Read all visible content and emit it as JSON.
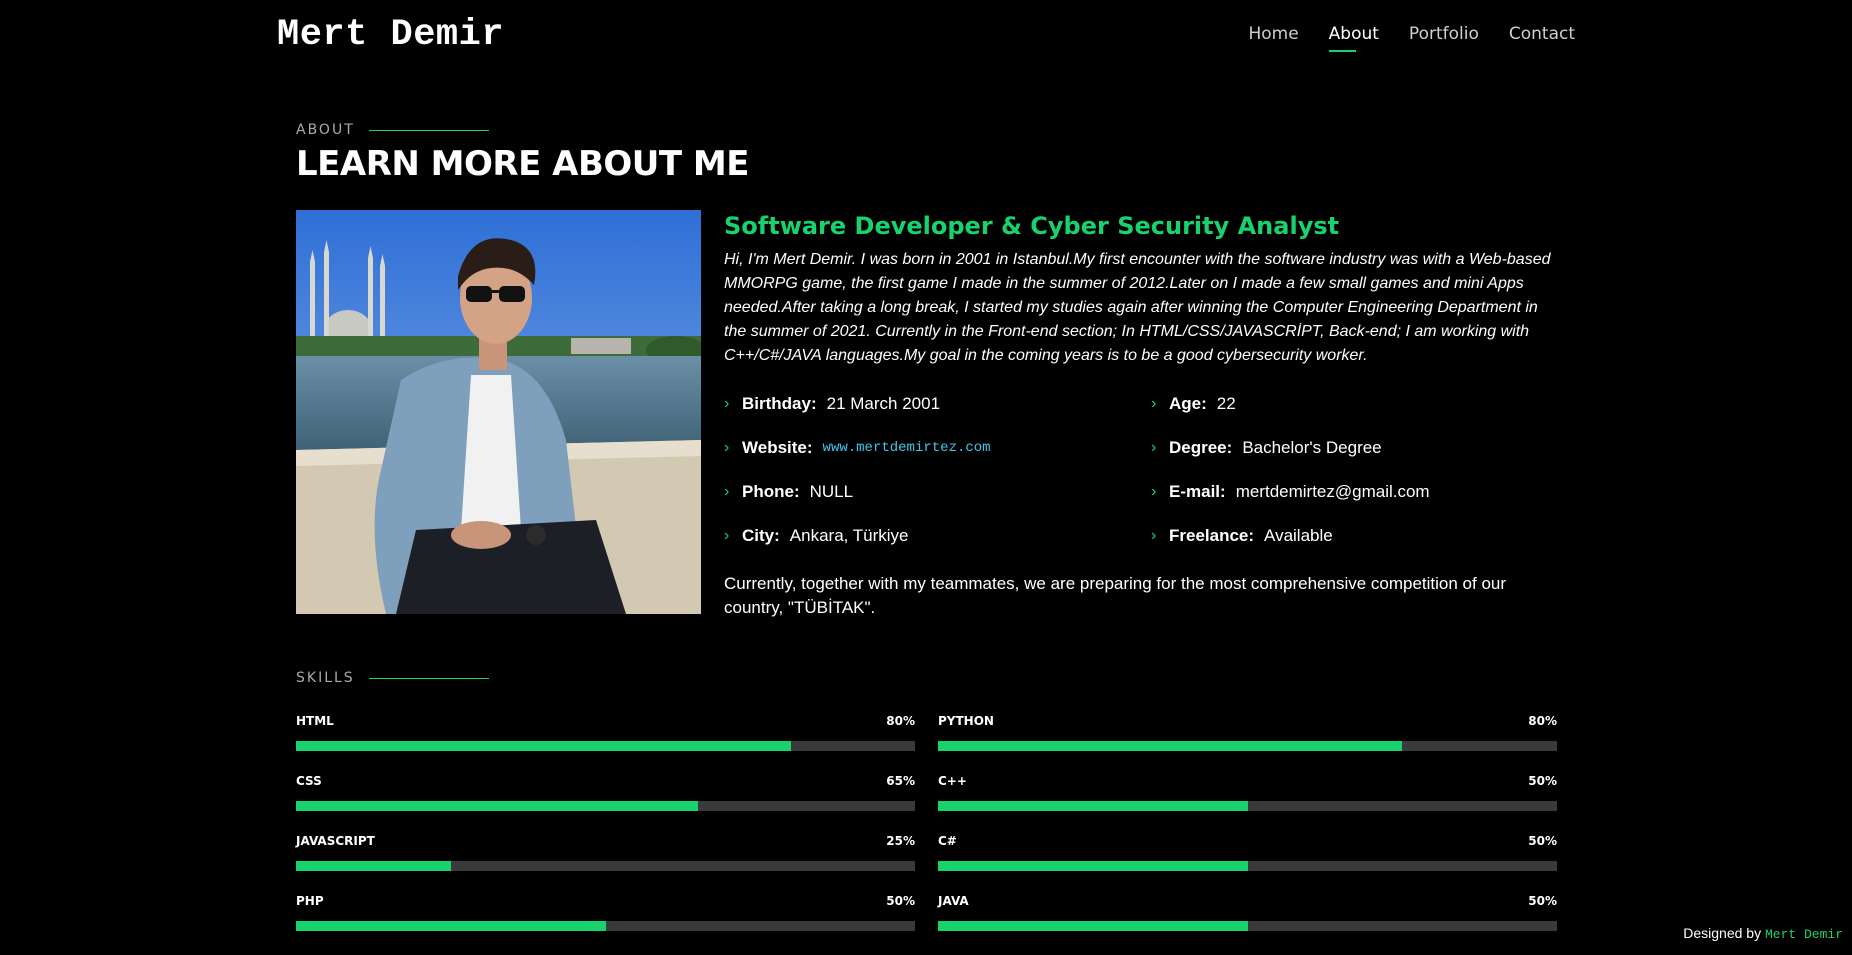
{
  "header": {
    "logo": "Mert Demir",
    "nav": [
      {
        "label": "Home",
        "active": false
      },
      {
        "label": "About",
        "active": true
      },
      {
        "label": "Portfolio",
        "active": false
      },
      {
        "label": "Contact",
        "active": false
      }
    ]
  },
  "about": {
    "label": "ABOUT",
    "title": "LEARN MORE ABOUT ME",
    "role": "Software Developer & Cyber Security Analyst",
    "bio": "Hi, I'm Mert Demir. I was born in 2001 in Istanbul.My first encounter with the software industry was with a Web-based MMORPG game, the first game I made in the summer of 2012.Later on I made a few small games and mini Apps needed.After taking a long break, I started my studies again after winning the Computer Engineering Department in the summer of 2021. Currently in the Front-end section; In HTML/CSS/JAVASCRİPT, Back-end; I am working with C++/C#/JAVA languages.My goal in the coming years is to be a good cybersecurity worker.",
    "info": [
      {
        "key": "Birthday:",
        "value": "21 March 2001"
      },
      {
        "key": "Age:",
        "value": "22"
      },
      {
        "key": "Website:",
        "value": "www.mertdemirtez.com"
      },
      {
        "key": "Degree:",
        "value": "Bachelor's Degree"
      },
      {
        "key": "Phone:",
        "value": "NULL"
      },
      {
        "key": "E-mail:",
        "value": "mertdemirtez@gmail.com"
      },
      {
        "key": "City:",
        "value": "Ankara, Türkiye"
      },
      {
        "key": "Freelance:",
        "value": "Available"
      }
    ],
    "note": "Currently, together with my teammates, we are preparing for the most comprehensive competition of our country, \"TÜBİTAK\"."
  },
  "skills": {
    "label": "SKILLS",
    "items": [
      {
        "name": "HTML",
        "value": "80%",
        "level": 80
      },
      {
        "name": "PYTHON",
        "value": "80%",
        "level": 75
      },
      {
        "name": "CSS",
        "value": "65%",
        "level": 65
      },
      {
        "name": "C++",
        "value": "50%",
        "level": 50
      },
      {
        "name": "JAVASCRIPT",
        "value": "25%",
        "level": 25
      },
      {
        "name": "C#",
        "value": "50%",
        "level": 50
      },
      {
        "name": "PHP",
        "value": "50%",
        "level": 50
      },
      {
        "name": "JAVA",
        "value": "50%",
        "level": 50
      }
    ]
  },
  "footer": {
    "prefix": "Designed by",
    "name": "Mert Demir"
  },
  "colors": {
    "accent": "#18d26e",
    "link": "#3fc5e8",
    "background": "#000000",
    "track": "#3a3a3a"
  }
}
